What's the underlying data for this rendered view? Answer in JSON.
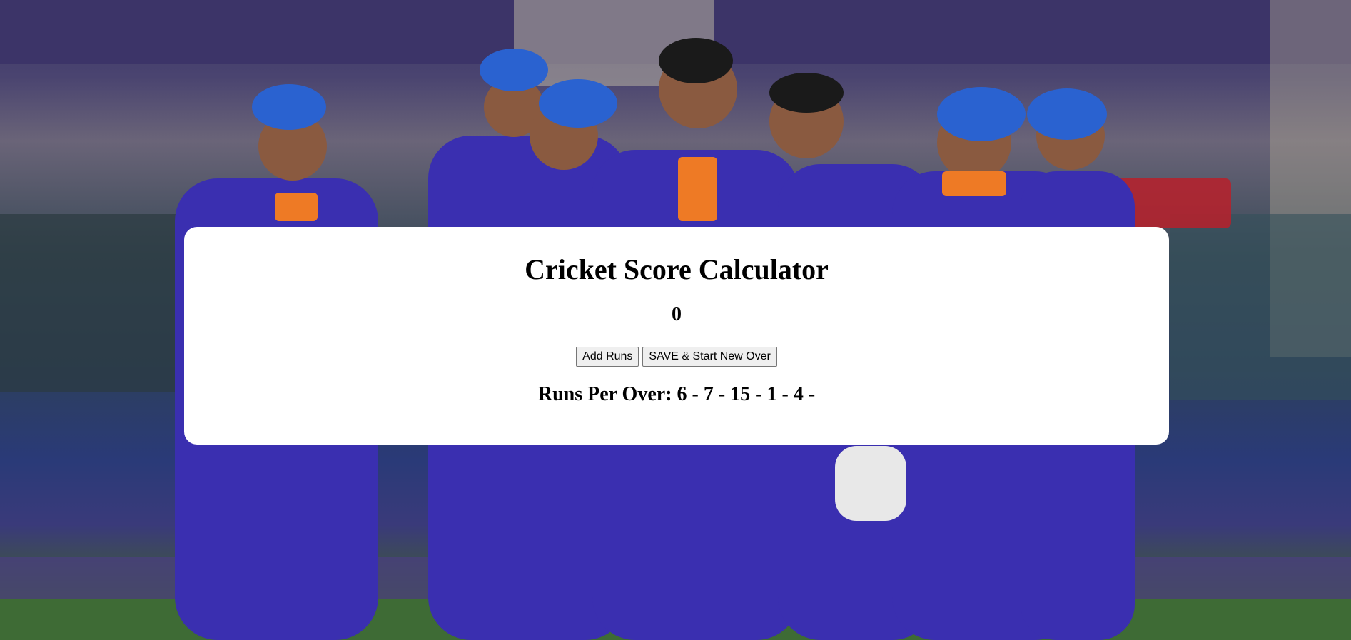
{
  "app": {
    "title": "Cricket Score Calculator"
  },
  "score": {
    "value": "0"
  },
  "actions": {
    "add_runs_label": "Add Runs",
    "save_label": "SAVE & Start New Over"
  },
  "runs_per_over": {
    "label": "Runs Per Over:",
    "values": [
      "6",
      "7",
      "15",
      "1",
      "4"
    ],
    "text": "Runs Per Over: 6 - 7 - 15 - 1 - 4 -"
  }
}
